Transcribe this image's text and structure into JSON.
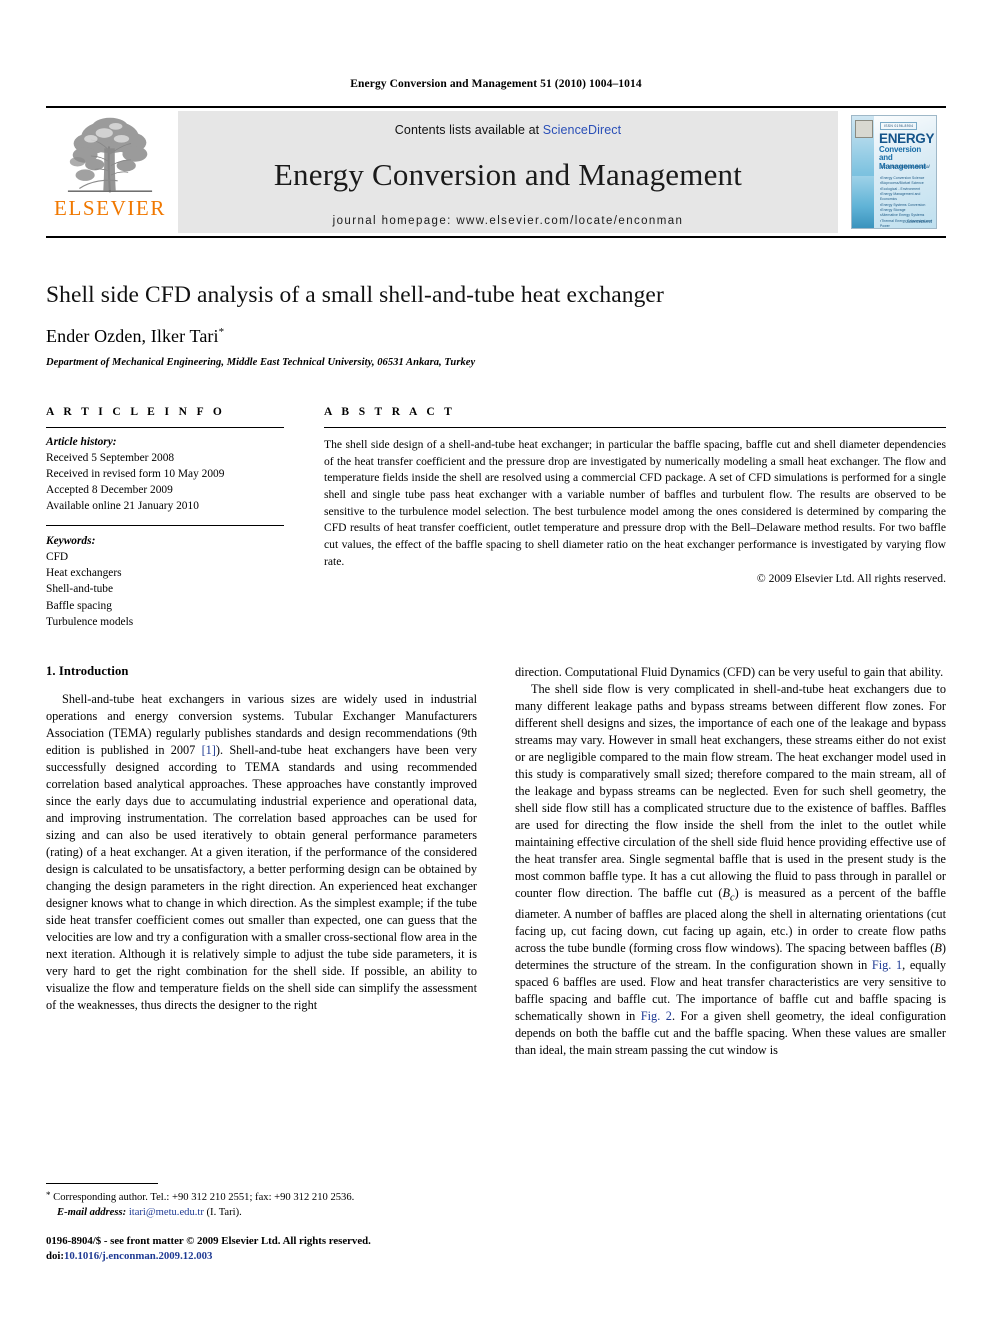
{
  "running_head": "Energy Conversion and Management 51 (2010) 1004–1014",
  "masthead": {
    "contents_prefix": "Contents lists available at ",
    "sciencedirect": "ScienceDirect",
    "journal_title": "Energy Conversion and Management",
    "homepage": "journal homepage: www.elsevier.com/locate/enconman",
    "publisher_name": "ELSEVIER",
    "cover": {
      "kicker": "ISSN 0196-8904",
      "title_line1": "ENERGY",
      "title_line2": "Conversion and",
      "title_line3": "Management",
      "subtitle": "An International Journal",
      "bullets": [
        "Energy Conversion Science",
        "Bioprocess/Biofuel Science",
        "Ecological - Environment",
        "Energy Management and Economics",
        "Energy Systems Conversion",
        "Energy Storage",
        "Alternative Energy Systems",
        "Thermal Energy Conversion and Power"
      ],
      "logo": "ScienceDirect"
    }
  },
  "article": {
    "title": "Shell side CFD analysis of a small shell-and-tube heat exchanger",
    "authors": "Ender Ozden, Ilker Tari",
    "corresponding_marker": "*",
    "affiliation": "Department of Mechanical Engineering, Middle East Technical University, 06531 Ankara, Turkey"
  },
  "article_info": {
    "heading": "A R T I C L E    I N F O",
    "history_label": "Article history:",
    "history": [
      "Received 5 September 2008",
      "Received in revised form 10 May 2009",
      "Accepted 8 December 2009",
      "Available online 21 January 2010"
    ],
    "keywords_label": "Keywords:",
    "keywords": [
      "CFD",
      "Heat exchangers",
      "Shell-and-tube",
      "Baffle spacing",
      "Turbulence models"
    ]
  },
  "abstract": {
    "heading": "A B S T R A C T",
    "text": "The shell side design of a shell-and-tube heat exchanger; in particular the baffle spacing, baffle cut and shell diameter dependencies of the heat transfer coefficient and the pressure drop are investigated by numerically modeling a small heat exchanger. The flow and temperature fields inside the shell are resolved using a commercial CFD package. A set of CFD simulations is performed for a single shell and single tube pass heat exchanger with a variable number of baffles and turbulent flow. The results are observed to be sensitive to the turbulence model selection. The best turbulence model among the ones considered is determined by comparing the CFD results of heat transfer coefficient, outlet temperature and pressure drop with the Bell–Delaware method results. For two baffle cut values, the effect of the baffle spacing to shell diameter ratio on the heat exchanger performance is investigated by varying flow rate.",
    "copyright": "© 2009 Elsevier Ltd. All rights reserved."
  },
  "body": {
    "section_heading": "1. Introduction",
    "left_paragraphs": [
      "Shell-and-tube heat exchangers in various sizes are widely used in industrial operations and energy conversion systems. Tubular Exchanger Manufacturers Association (TEMA) regularly publishes standards and design recommendations (9th edition is published in 2007 [1]). Shell-and-tube heat exchangers have been very successfully designed according to TEMA standards and using recommended correlation based analytical approaches. These approaches have constantly improved since the early days due to accumulating industrial experience and operational data, and improving instrumentation. The correlation based approaches can be used for sizing and can also be used iteratively to obtain general performance parameters (rating) of a heat exchanger. At a given iteration, if the performance of the considered design is calculated to be unsatisfactory, a better performing design can be obtained by changing the design parameters in the right direction. An experienced heat exchanger designer knows what to change in which direction. As the simplest example; if the tube side heat transfer coefficient comes out smaller than expected, one can guess that the velocities are low and try a configuration with a smaller cross-sectional flow area in the next iteration. Although it is relatively simple to adjust the tube side parameters, it is very hard to get the right combination for the shell side. If possible, an ability to visualize the flow and temperature fields on the shell side can simplify the assessment of the weaknesses, thus directs the designer to the right"
    ],
    "left_inline_ref": "[1]",
    "right_paragraphs": [
      "direction. Computational Fluid Dynamics (CFD) can be very useful to gain that ability.",
      "The shell side flow is very complicated in shell-and-tube heat exchangers due to many different leakage paths and bypass streams between different flow zones. For different shell designs and sizes, the importance of each one of the leakage and bypass streams may vary. However in small heat exchangers, these streams either do not exist or are negligible compared to the main flow stream. The heat exchanger model used in this study is comparatively small sized; therefore compared to the main stream, all of the leakage and bypass streams can be neglected. Even for such shell geometry, the shell side flow still has a complicated structure due to the existence of baffles. Baffles are used for directing the flow inside the shell from the inlet to the outlet while maintaining effective circulation of the shell side fluid hence providing effective use of the heat transfer area. Single segmental baffle that is used in the present study is the most common baffle type. It has a cut allowing the fluid to pass through in parallel or counter flow direction. The baffle cut (Bc) is measured as a percent of the baffle diameter. A number of baffles are placed along the shell in alternating orientations (cut facing up, cut facing down, cut facing up again, etc.) in order to create flow paths across the tube bundle (forming cross flow windows). The spacing between baffles (B) determines the structure of the stream. In the configuration shown in Fig. 1, equally spaced 6 baffles are used. Flow and heat transfer characteristics are very sensitive to baffle spacing and baffle cut. The importance of baffle cut and baffle spacing is schematically shown in Fig. 2. For a given shell geometry, the ideal configuration depends on both the baffle cut and the baffle spacing. When these values are smaller than ideal, the main stream passing the cut window is"
    ],
    "fig_refs": [
      "Fig. 1",
      "Fig. 2"
    ]
  },
  "footnote": {
    "marker": "*",
    "line1": "Corresponding author. Tel.: +90 312 210 2551; fax: +90 312 210 2536.",
    "email_label": "E-mail address:",
    "email": "itari@metu.edu.tr",
    "email_suffix": "(I. Tari)."
  },
  "page_footer": {
    "issn_line": "0196-8904/$ - see front matter © 2009 Elsevier Ltd. All rights reserved.",
    "doi_label": "doi:",
    "doi": "10.1016/j.enconman.2009.12.003"
  },
  "colors": {
    "link": "#1f3a93",
    "sciencedirect": "#2a4fb7",
    "elsevier_orange": "#F07800",
    "masthead_bg": "#e6e6e6"
  }
}
